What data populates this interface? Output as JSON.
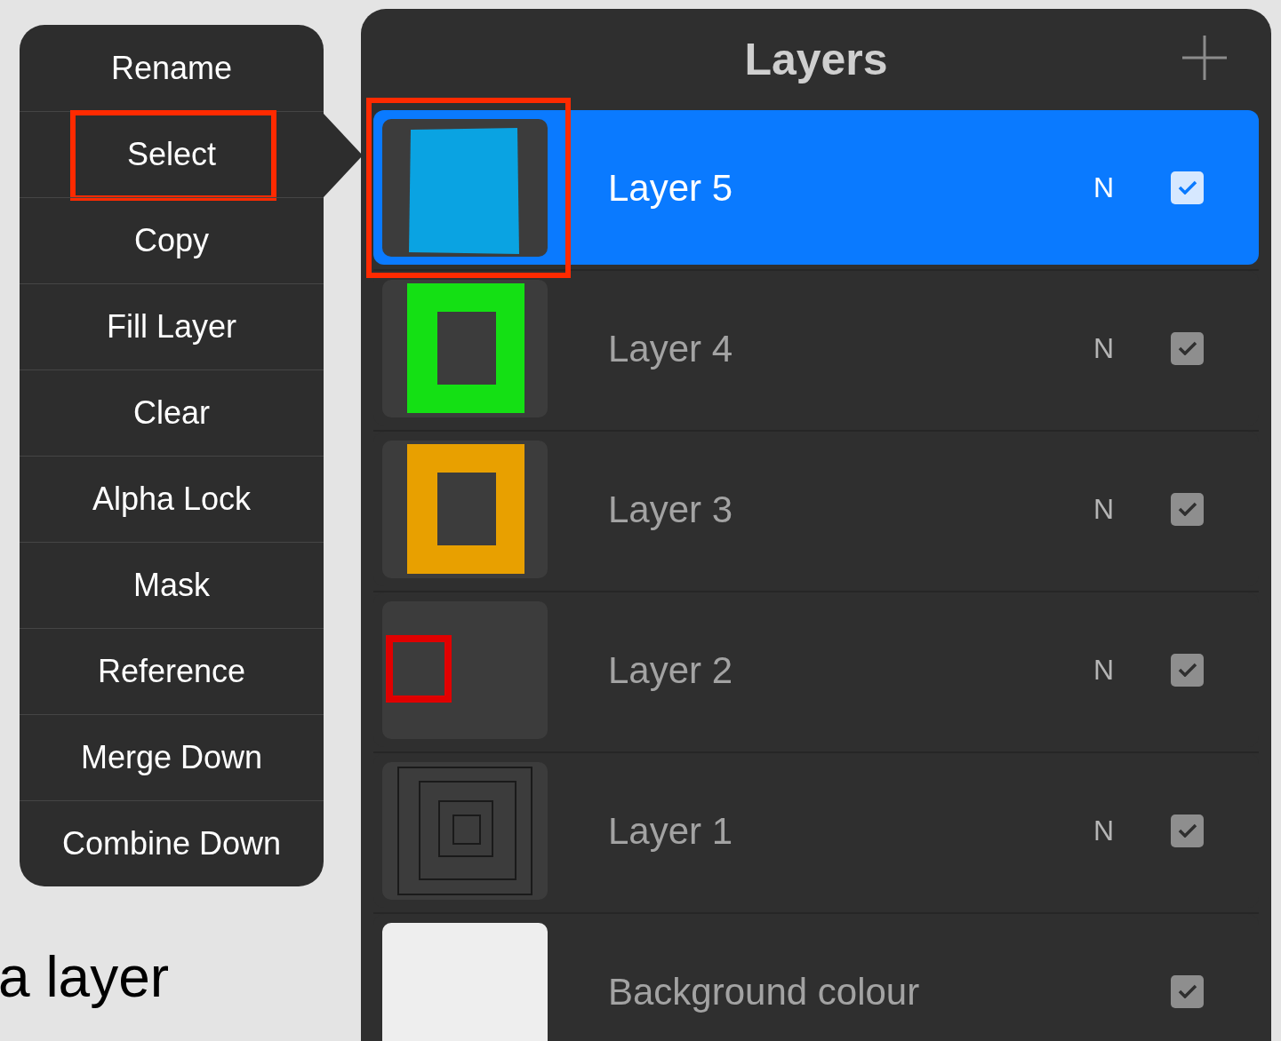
{
  "menu": {
    "items": [
      {
        "label": "Rename",
        "annotated": false
      },
      {
        "label": "Select",
        "annotated": true
      },
      {
        "label": "Copy",
        "annotated": false
      },
      {
        "label": "Fill Layer",
        "annotated": false
      },
      {
        "label": "Clear",
        "annotated": false
      },
      {
        "label": "Alpha Lock",
        "annotated": false
      },
      {
        "label": "Mask",
        "annotated": false
      },
      {
        "label": "Reference",
        "annotated": false
      },
      {
        "label": "Merge Down",
        "annotated": false
      },
      {
        "label": "Combine Down",
        "annotated": false
      }
    ]
  },
  "caption": "a layer",
  "layers_panel": {
    "title": "Layers",
    "layers": [
      {
        "name": "Layer 5",
        "blend": "N",
        "visible": true,
        "selected": true,
        "annotated": true,
        "kind": "fill",
        "color": "#0aa3e2"
      },
      {
        "name": "Layer 4",
        "blend": "N",
        "visible": true,
        "selected": false,
        "annotated": false,
        "kind": "frame",
        "color": "#14e014"
      },
      {
        "name": "Layer 3",
        "blend": "N",
        "visible": true,
        "selected": false,
        "annotated": false,
        "kind": "frame",
        "color": "#e8a000"
      },
      {
        "name": "Layer 2",
        "blend": "N",
        "visible": true,
        "selected": false,
        "annotated": false,
        "kind": "small-frame",
        "color": "#e00000"
      },
      {
        "name": "Layer 1",
        "blend": "N",
        "visible": true,
        "selected": false,
        "annotated": false,
        "kind": "nested-frames",
        "color": "#1a1a1a"
      },
      {
        "name": "Background colour",
        "visible": true,
        "selected": false,
        "annotated": false,
        "kind": "solid",
        "color": "#eeeeee"
      }
    ]
  }
}
